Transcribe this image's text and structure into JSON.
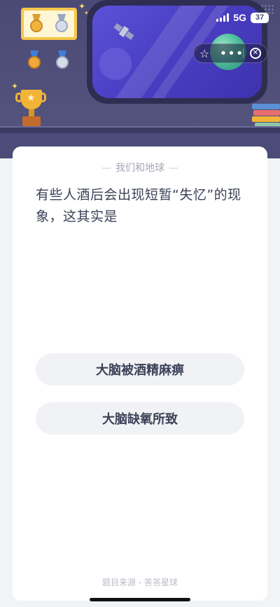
{
  "status_bar": {
    "network": "5G",
    "battery": "37"
  },
  "capsule": {
    "favorite_icon": "star-outline-icon",
    "more_icon": "more-dots-icon",
    "close_icon": "close-circle-icon"
  },
  "quiz": {
    "category": "我们和地球",
    "question": "有些人酒后会出现短暂“失忆”的现象，这其实是",
    "options": [
      {
        "label": "大脑被酒精麻痹"
      },
      {
        "label": "大脑缺氧所致"
      }
    ],
    "source": "题目来源 - 答答星球"
  },
  "colors": {
    "scene_bg": "#4a4a75",
    "card_bg": "#ffffff",
    "page_bg": "#f2f3f7",
    "text_primary": "#3c4257",
    "text_muted": "#a4a8b6",
    "option_bg": "#f1f2f5",
    "trophy_gold": "#f2b437",
    "window_glass": "#5a52d6"
  }
}
